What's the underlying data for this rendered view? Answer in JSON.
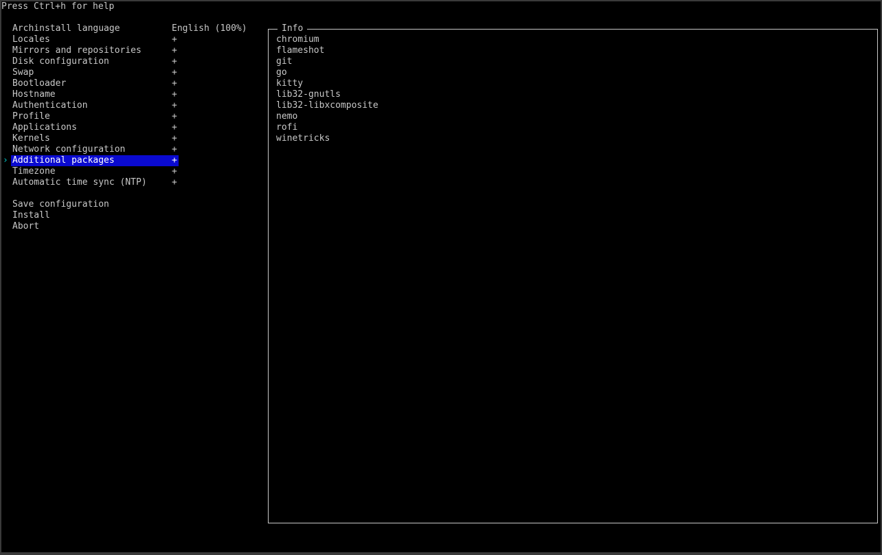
{
  "help_text": "Press Ctrl+h for help",
  "cursor_glyph": "›",
  "menu": {
    "items": [
      {
        "label": "Archinstall language",
        "value": "English (100%)"
      },
      {
        "label": "Locales",
        "value": "+"
      },
      {
        "label": "Mirrors and repositories",
        "value": "+"
      },
      {
        "label": "Disk configuration",
        "value": "+"
      },
      {
        "label": "Swap",
        "value": "+"
      },
      {
        "label": "Bootloader",
        "value": "+"
      },
      {
        "label": "Hostname",
        "value": "+"
      },
      {
        "label": "Authentication",
        "value": "+"
      },
      {
        "label": "Profile",
        "value": "+"
      },
      {
        "label": "Applications",
        "value": "+"
      },
      {
        "label": "Kernels",
        "value": "+"
      },
      {
        "label": "Network configuration",
        "value": "+"
      },
      {
        "label": "Additional packages",
        "value": "+"
      },
      {
        "label": "Timezone",
        "value": "+"
      },
      {
        "label": "Automatic time sync (NTP)",
        "value": "+"
      }
    ],
    "selected_index": 12,
    "actions": [
      {
        "label": "Save configuration"
      },
      {
        "label": "Install"
      },
      {
        "label": "Abort"
      }
    ]
  },
  "info": {
    "title": "Info",
    "lines": [
      "chromium",
      "flameshot",
      "git",
      "go",
      "kitty",
      "lib32-gnutls",
      "lib32-libxcomposite",
      "nemo",
      "rofi",
      "winetricks"
    ]
  },
  "colors": {
    "background": "#000000",
    "text": "#c8c8c8",
    "selected_bg": "#0a0ad0",
    "selected_text": "#ffffff",
    "cursor": "#00c8c8"
  }
}
